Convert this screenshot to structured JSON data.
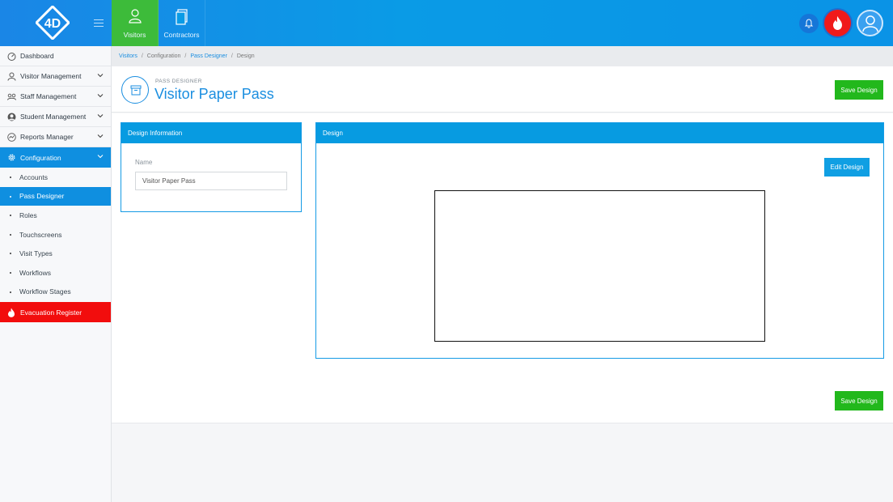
{
  "app": {
    "logo_text": "4D"
  },
  "topnav": [
    {
      "label": "Visitors",
      "icon": "visitor-icon",
      "active": true
    },
    {
      "label": "Contractors",
      "icon": "document-icon",
      "active": false
    }
  ],
  "sidebar": {
    "items": [
      {
        "label": "Dashboard",
        "icon": "dashboard-icon"
      },
      {
        "label": "Visitor Management",
        "icon": "user-icon"
      },
      {
        "label": "Staff Management",
        "icon": "group-icon"
      },
      {
        "label": "Student Management",
        "icon": "student-icon"
      },
      {
        "label": "Reports Manager",
        "icon": "chart-icon"
      },
      {
        "label": "Configuration",
        "icon": "gear-icon"
      }
    ],
    "subitems": [
      "Accounts",
      "Pass Designer",
      "Roles",
      "Touchscreens",
      "Visit Types",
      "Workflows",
      "Workflow Stages"
    ],
    "evacuation": "Evacuation Register"
  },
  "breadcrumb": [
    "Visitors",
    "Configuration",
    "Pass Designer",
    "Design"
  ],
  "header": {
    "subtitle": "PASS DESIGNER",
    "title": "Visitor Paper Pass",
    "save_label": "Save Design"
  },
  "design_info": {
    "title": "Design Information",
    "name_label": "Name",
    "name_value": "Visitor Paper Pass"
  },
  "design": {
    "title": "Design",
    "edit_label": "Edit Design"
  },
  "footer": {
    "save_label": "Save Design"
  },
  "colors": {
    "primary": "#0f8fe0",
    "success": "#22b81c",
    "danger": "#f20d0d"
  }
}
